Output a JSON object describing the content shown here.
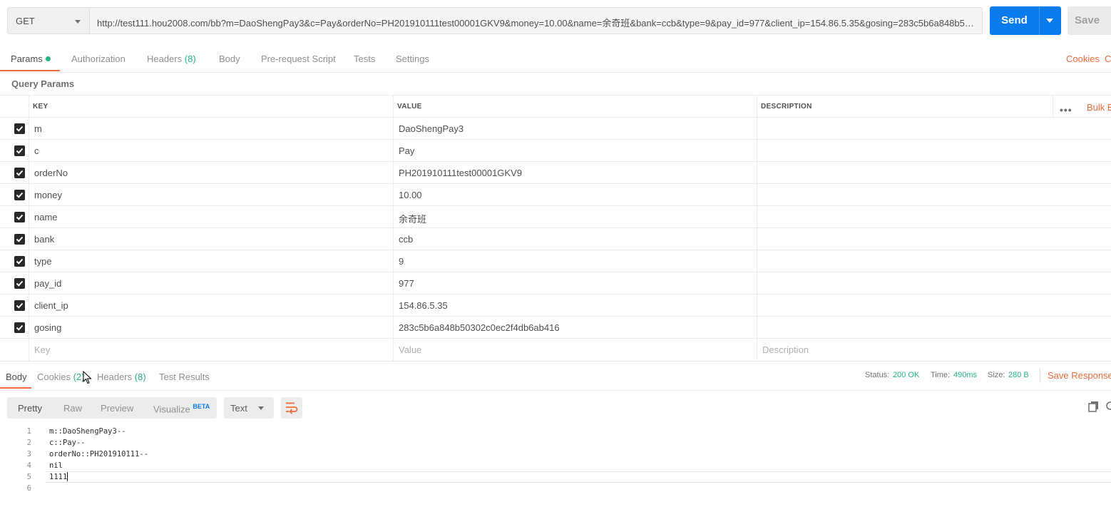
{
  "request": {
    "method": "GET",
    "url": "http://test111.hou2008.com/bb?m=DaoShengPay3&c=Pay&orderNo=PH201910111test00001GKV9&money=10.00&name=余奇班&bank=ccb&type=9&pay_id=977&client_ip=154.86.5.35&gosing=283c5b6a848b50302c0ec...",
    "send_label": "Send",
    "save_label": "Save"
  },
  "request_tabs": {
    "params": "Params",
    "authorization": "Authorization",
    "headers": "Headers",
    "headers_count": "(8)",
    "body": "Body",
    "prerequest": "Pre-request Script",
    "tests": "Tests",
    "settings": "Settings",
    "cookies_link": "Cookies",
    "code_link_partial": "Co"
  },
  "query_params": {
    "title": "Query Params",
    "headers": {
      "key": "KEY",
      "value": "VALUE",
      "description": "DESCRIPTION"
    },
    "bulk_edit_partial": "Bulk E",
    "rows": [
      {
        "key": "m",
        "value": "DaoShengPay3"
      },
      {
        "key": "c",
        "value": "Pay"
      },
      {
        "key": "orderNo",
        "value": "PH201910111test00001GKV9"
      },
      {
        "key": "money",
        "value": "10.00"
      },
      {
        "key": "name",
        "value": "余奇班"
      },
      {
        "key": "bank",
        "value": "ccb"
      },
      {
        "key": "type",
        "value": "9"
      },
      {
        "key": "pay_id",
        "value": "977"
      },
      {
        "key": "client_ip",
        "value": "154.86.5.35"
      },
      {
        "key": "gosing",
        "value": "283c5b6a848b50302c0ec2f4db6ab416"
      }
    ],
    "placeholders": {
      "key": "Key",
      "value": "Value",
      "description": "Description"
    }
  },
  "response": {
    "tabs": {
      "body": "Body",
      "cookies": "Cookies",
      "cookies_count": "(2)",
      "headers": "Headers",
      "headers_count": "(8)",
      "test_results": "Test Results"
    },
    "status_label": "Status:",
    "status_value": "200 OK",
    "time_label": "Time:",
    "time_value": "490ms",
    "size_label": "Size:",
    "size_value": "280 B",
    "save_response": "Save Response",
    "formats": {
      "pretty": "Pretty",
      "raw": "Raw",
      "preview": "Preview",
      "visualize": "Visualize",
      "beta": "BETA"
    },
    "language": "Text",
    "lines": [
      {
        "num": "1",
        "text": "m::DaoShengPay3--"
      },
      {
        "num": "2",
        "text": "c::Pay--"
      },
      {
        "num": "3",
        "text": "orderNo::PH201910111--"
      },
      {
        "num": "4",
        "text": "nil"
      },
      {
        "num": "5",
        "text": "1111"
      },
      {
        "num": "6",
        "text": ""
      }
    ]
  },
  "colors": {
    "accent_orange": "#f26b3a",
    "send_blue": "#097bed",
    "status_green": "#26b47f"
  }
}
